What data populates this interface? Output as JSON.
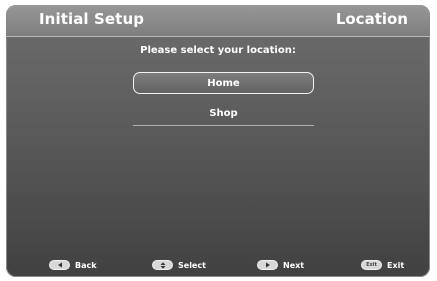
{
  "header": {
    "title": "Initial Setup",
    "section": "Location"
  },
  "main": {
    "prompt": "Please select your location:",
    "options": [
      {
        "label": "Home",
        "selected": true
      },
      {
        "label": "Shop",
        "selected": false
      }
    ]
  },
  "footer": {
    "hints": [
      {
        "key_icon": "left-arrow-icon",
        "label": "Back"
      },
      {
        "key_icon": "up-down-arrows-icon",
        "label": "Select"
      },
      {
        "key_icon": "right-arrow-icon",
        "label": "Next"
      },
      {
        "key_icon": "exit-key-icon",
        "key_text": "Exit",
        "label": "Exit"
      }
    ]
  },
  "colors": {
    "background_top": "#6e6e6e",
    "background_bottom": "#414141",
    "header": "#8b8b8b",
    "text": "#ffffff",
    "key": "#d8d8d8"
  }
}
